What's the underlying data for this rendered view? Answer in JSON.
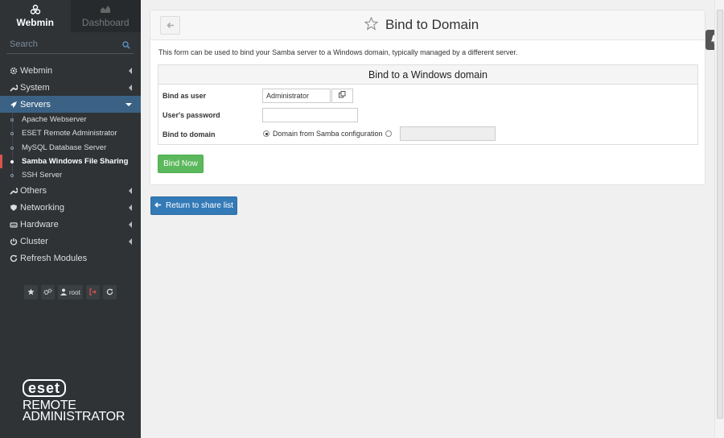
{
  "sidebar": {
    "tab_webmin": "Webmin",
    "tab_dashboard": "Dashboard",
    "search_placeholder": "Search",
    "menu": [
      {
        "label": "Webmin",
        "icon": "gear-icon"
      },
      {
        "label": "System",
        "icon": "wrench-icon"
      },
      {
        "label": "Servers",
        "icon": "rocket-icon"
      }
    ],
    "servers_sub": [
      {
        "label": "Apache Webserver"
      },
      {
        "label": "ESET Remote Administrator"
      },
      {
        "label": "MySQL Database Server"
      },
      {
        "label": "Samba Windows File Sharing"
      },
      {
        "label": "SSH Server"
      }
    ],
    "menu_after": [
      {
        "label": "Others",
        "icon": "wrench-icon"
      },
      {
        "label": "Networking",
        "icon": "shield-icon"
      },
      {
        "label": "Hardware",
        "icon": "hdd-icon"
      },
      {
        "label": "Cluster",
        "icon": "power-icon"
      },
      {
        "label": "Refresh Modules",
        "icon": "refresh-icon"
      }
    ],
    "user": "root",
    "logo_word": "eset",
    "logo_line1": "REMOTE",
    "logo_line2": "ADMINISTRATOR"
  },
  "page": {
    "title": "Bind to Domain",
    "intro": "This form can be used to bind your Samba server to a Windows domain, typically managed by a different server.",
    "form_title": "Bind to a Windows domain",
    "bind_user_label": "Bind as user",
    "bind_user_value": "Administrator",
    "password_label": "User's password",
    "password_value": "",
    "domain_label": "Bind to domain",
    "domain_option_samba": "Domain from Samba configuration",
    "domain_custom_value": "",
    "bind_button": "Bind Now",
    "return_button": "Return to share list"
  },
  "colors": {
    "sidebar_bg": "#2f3336",
    "active_menu": "#3b6285",
    "bind_button": "#5cb85c",
    "return_button": "#337ab7",
    "active_marker": "#d9534f"
  }
}
